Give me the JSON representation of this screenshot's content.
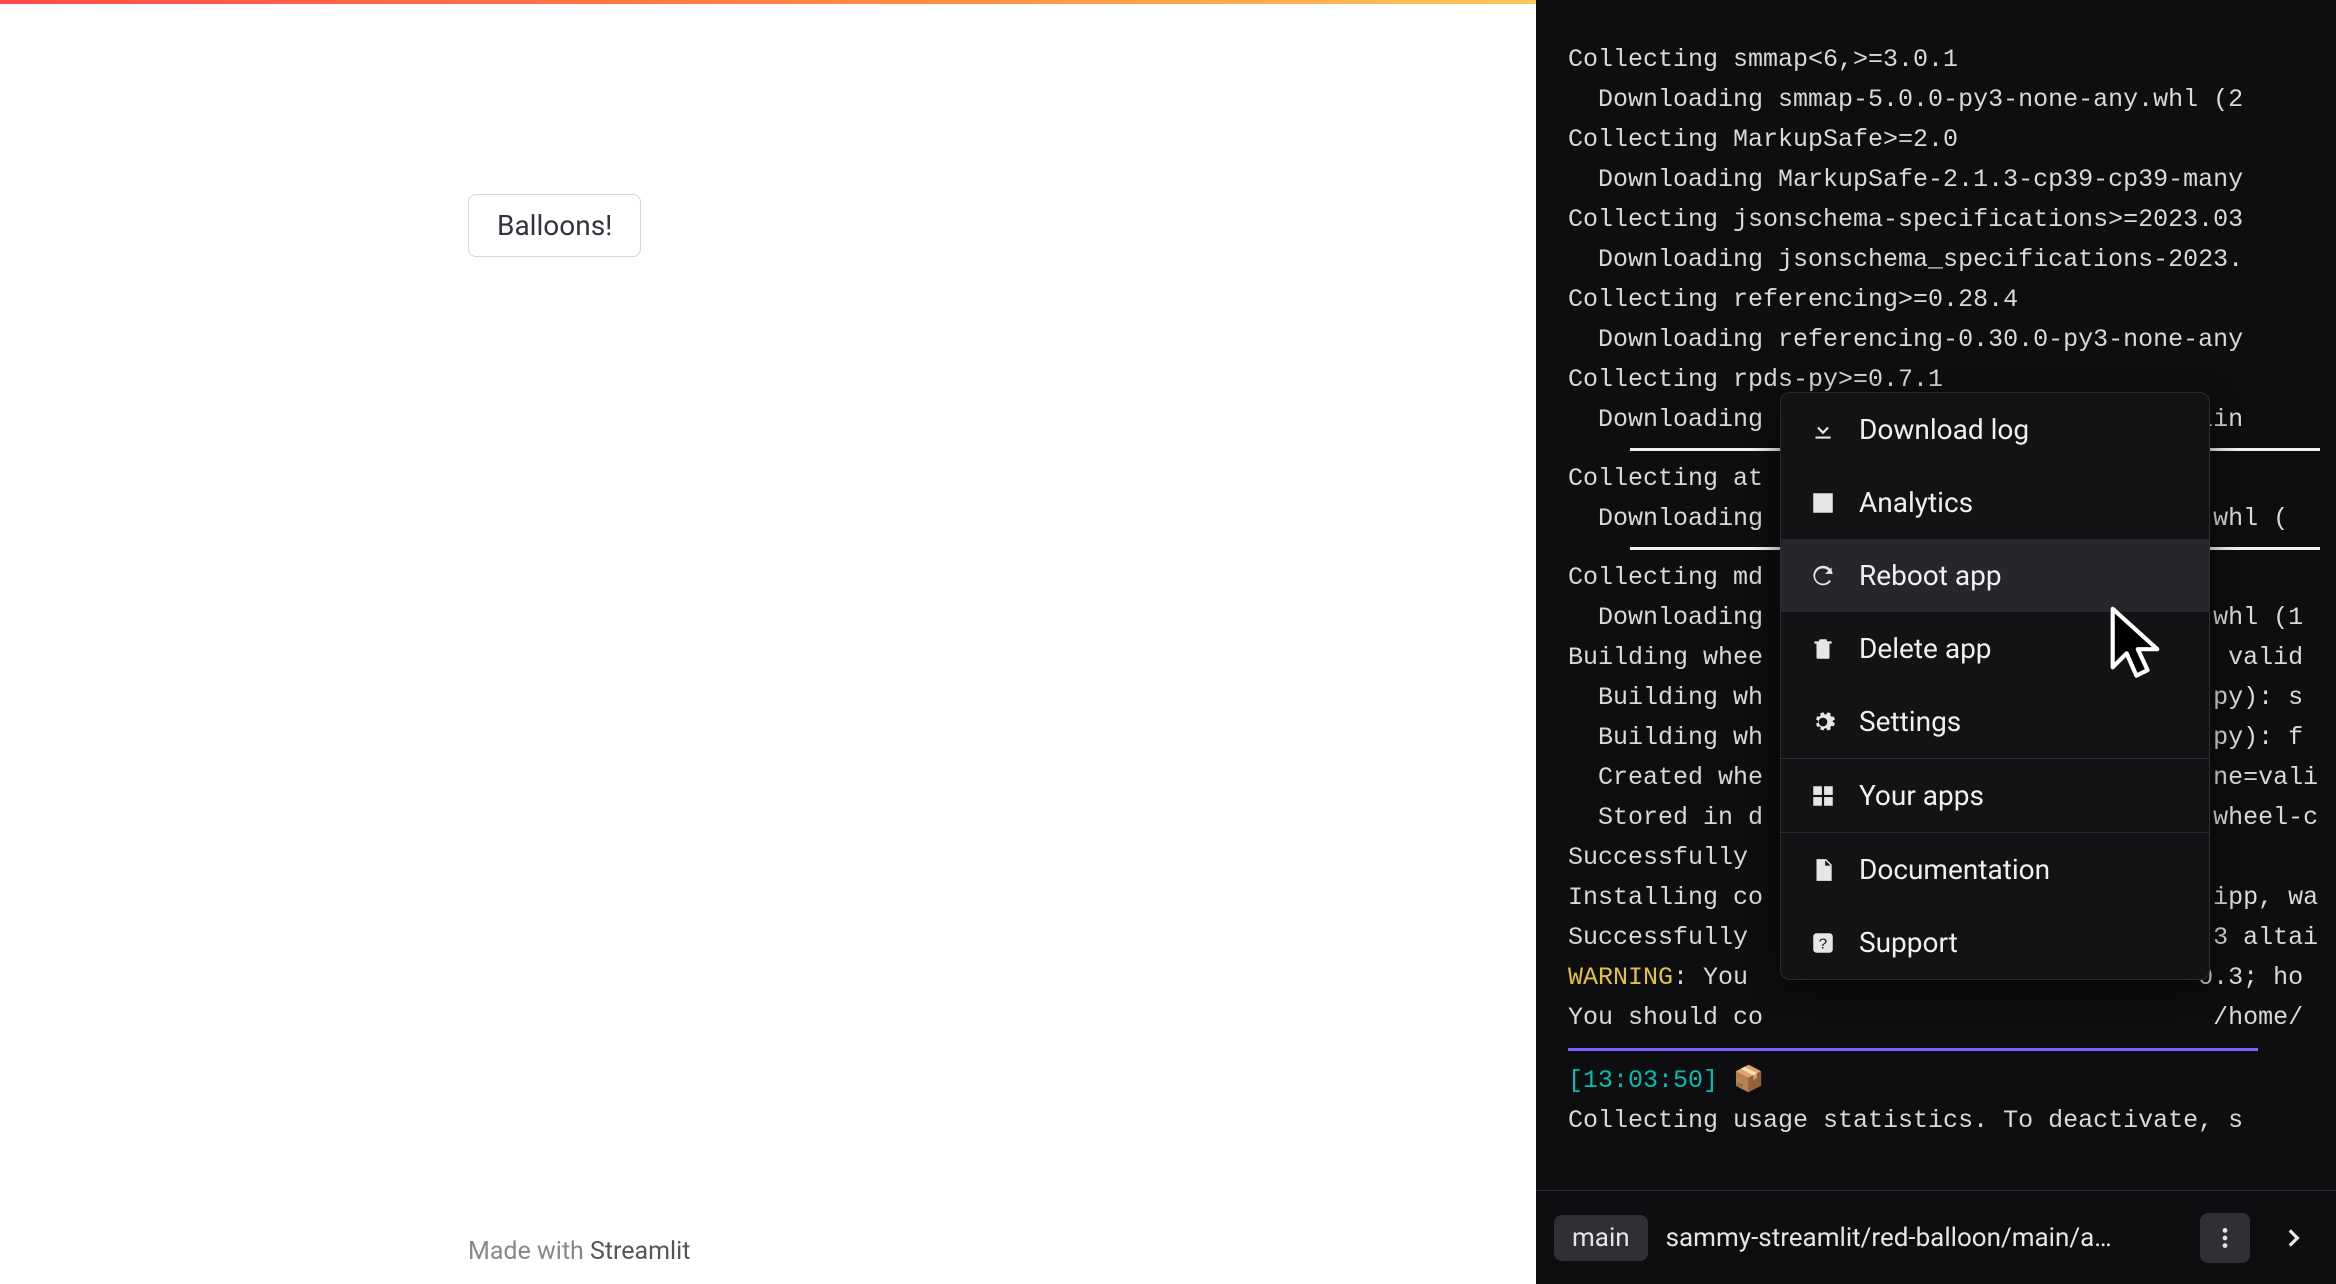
{
  "app": {
    "button_label": "Balloons!",
    "footer_prefix": "Made with ",
    "footer_brand": "Streamlit"
  },
  "terminal": {
    "lines": [
      "Collecting smmap<6,>=3.0.1",
      "  Downloading smmap-5.0.0-py3-none-any.whl (2",
      "Collecting MarkupSafe>=2.0",
      "  Downloading MarkupSafe-2.1.3-cp39-cp39-many",
      "Collecting jsonschema-specifications>=2023.03",
      "  Downloading jsonschema_specifications-2023.",
      "Collecting referencing>=0.28.4",
      "  Downloading referencing-0.30.0-py3-none-any",
      "Collecting rpds-py>=0.7.1",
      "  Downloading rpds_py-0.9.2-cp39-cp39-manylin"
    ],
    "lines2": [
      "Collecting at",
      "  Downloading                             .whl ("
    ],
    "lines3": [
      "Collecting md",
      "  Downloading                             .whl (1",
      "Building whee                               valid",
      "  Building wh                              py): s",
      "  Building wh                              py): f",
      "  Created whe                              ne=vali",
      "  Stored in d                              wheel-c",
      "Successfully ",
      "Installing co                              ipp, wa",
      "Successfully                               3 altai"
    ],
    "warning_prefix": "WARNING",
    "warning_rest": ": You                              0.3; ho",
    "after_warning": "You should co                              /home/",
    "timestamp": "[13:03:50]",
    "emoji": "📦",
    "last_line": "Collecting usage statistics. To deactivate, s"
  },
  "menu": {
    "download_log": "Download log",
    "analytics": "Analytics",
    "reboot": "Reboot app",
    "delete": "Delete app",
    "settings": "Settings",
    "your_apps": "Your apps",
    "documentation": "Documentation",
    "support": "Support"
  },
  "bottom": {
    "branch": "main",
    "repo": "sammy-streamlit/red-balloon/main/a…"
  }
}
